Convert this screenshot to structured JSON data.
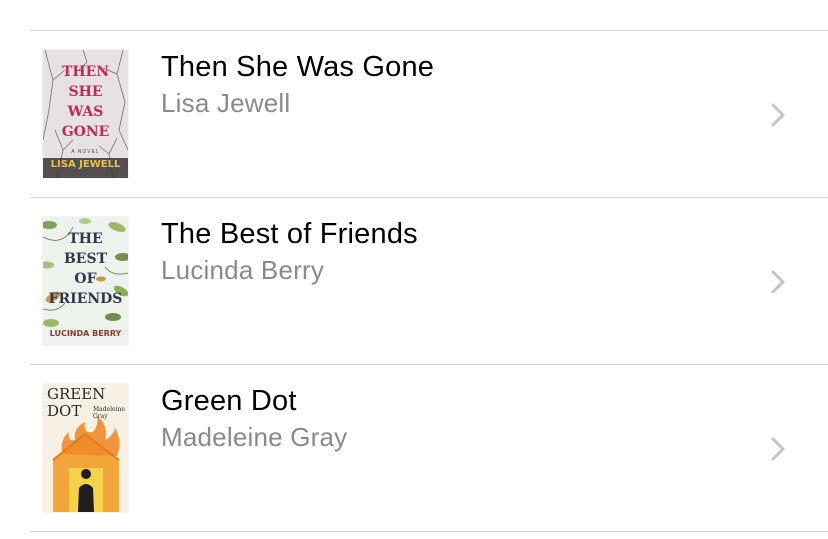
{
  "books": [
    {
      "title": "Then She Was Gone",
      "author": "Lisa Jewell",
      "cover": {
        "lines": [
          "THEN",
          "SHE",
          "WAS",
          "GONE"
        ],
        "author": "LISA JEWELL",
        "small": "A NOVEL",
        "bg": "#e8e4e6",
        "title_color": "#c02a56",
        "author_color": "#e6c447"
      },
      "icon": "chevron-right-icon"
    },
    {
      "title": "The Best of Friends",
      "author": "Lucinda Berry",
      "cover": {
        "lines": [
          "THE",
          "BEST",
          "OF",
          "FRIENDS"
        ],
        "author": "LUCINDA BERRY",
        "bg": "#eef3ee",
        "title_color": "#2e3a4a",
        "author_color": "#8a3b2a"
      },
      "icon": "chevron-right-icon"
    },
    {
      "title": "Green Dot",
      "author": "Madeleine Gray",
      "cover": {
        "lines": [
          "GREEN",
          "DOT"
        ],
        "author": "Madeleine Gray",
        "bg": "#f7f1e4",
        "title_color": "#2a2a2a",
        "accent": "#f2a53a"
      },
      "icon": "chevron-right-icon"
    }
  ],
  "colors": {
    "separator": "#d9d9dc",
    "secondary_text": "#8a8a8e",
    "chevron": "#c4c4c7"
  }
}
